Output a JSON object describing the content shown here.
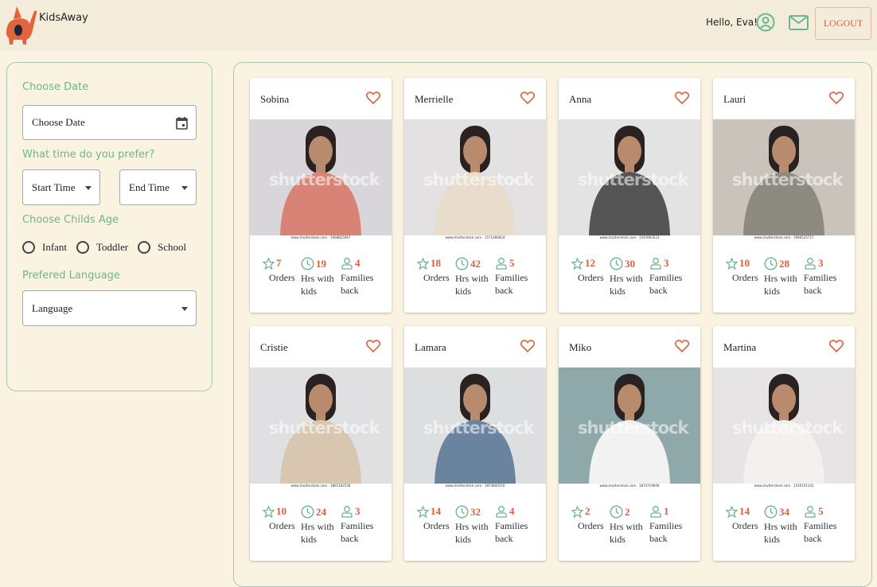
{
  "header": {
    "brand": "KidsAway",
    "greeting": "Hello, Eva!",
    "logout": "LOGOUT"
  },
  "colors": {
    "accent": "#6bb592",
    "brand": "#d9603c"
  },
  "filters": {
    "date_label": "Choose Date",
    "date_placeholder": "Choose Date",
    "time_label": "What time do you prefer?",
    "start_time": "Start Time",
    "end_time": "End Time",
    "age_label": "Choose Childs Age",
    "ages": [
      "Infant",
      "Toddler",
      "School"
    ],
    "language_label": "Prefered Language",
    "language": "Language"
  },
  "stat_labels": {
    "orders": "Orders",
    "hours_1": "Hrs with",
    "hours_2": "kids",
    "families_1": "Families",
    "families_2": "back"
  },
  "watermark": "shutterstock",
  "sitters": [
    {
      "name": "Sobina",
      "orders": "7",
      "hours": "19",
      "families": "4",
      "photo_id": "www.shutterstock.com · 1668825967",
      "bg": "#d8d6da",
      "shirt": "#d98276"
    },
    {
      "name": "Merrielle",
      "orders": "18",
      "hours": "42",
      "families": "5",
      "photo_id": "www.shutterstock.com · 1571480824",
      "bg": "#e4e1e3",
      "shirt": "#e8dccc"
    },
    {
      "name": "Anna",
      "orders": "12",
      "hours": "30",
      "families": "3",
      "photo_id": "www.shutterstock.com · 1543963523",
      "bg": "#e4e3e3",
      "shirt": "#555"
    },
    {
      "name": "Lauri",
      "orders": "10",
      "hours": "28",
      "families": "3",
      "photo_id": "www.shutterstock.com · 1696525717",
      "bg": "#c9c3bb",
      "shirt": "#8d8a80"
    },
    {
      "name": "Cristie",
      "orders": "10",
      "hours": "24",
      "families": "3",
      "photo_id": "www.shutterstock.com · 1865182558",
      "bg": "#e0e0e2",
      "shirt": "#d8c6b0"
    },
    {
      "name": "Lamara",
      "orders": "14",
      "hours": "32",
      "families": "4",
      "photo_id": "www.shutterstock.com · 1874800516",
      "bg": "#dcdee0",
      "shirt": "#6a84a0"
    },
    {
      "name": "Miko",
      "orders": "2",
      "hours": "2",
      "families": "1",
      "photo_id": "www.shutterstock.com · 1874719606",
      "bg": "#8fa9ab",
      "shirt": "#f2f2f2"
    },
    {
      "name": "Martina",
      "orders": "14",
      "hours": "34",
      "families": "5",
      "photo_id": "www.shutterstock.com · 1530741143",
      "bg": "#e6e4e4",
      "shirt": "#f4f0ee"
    }
  ]
}
